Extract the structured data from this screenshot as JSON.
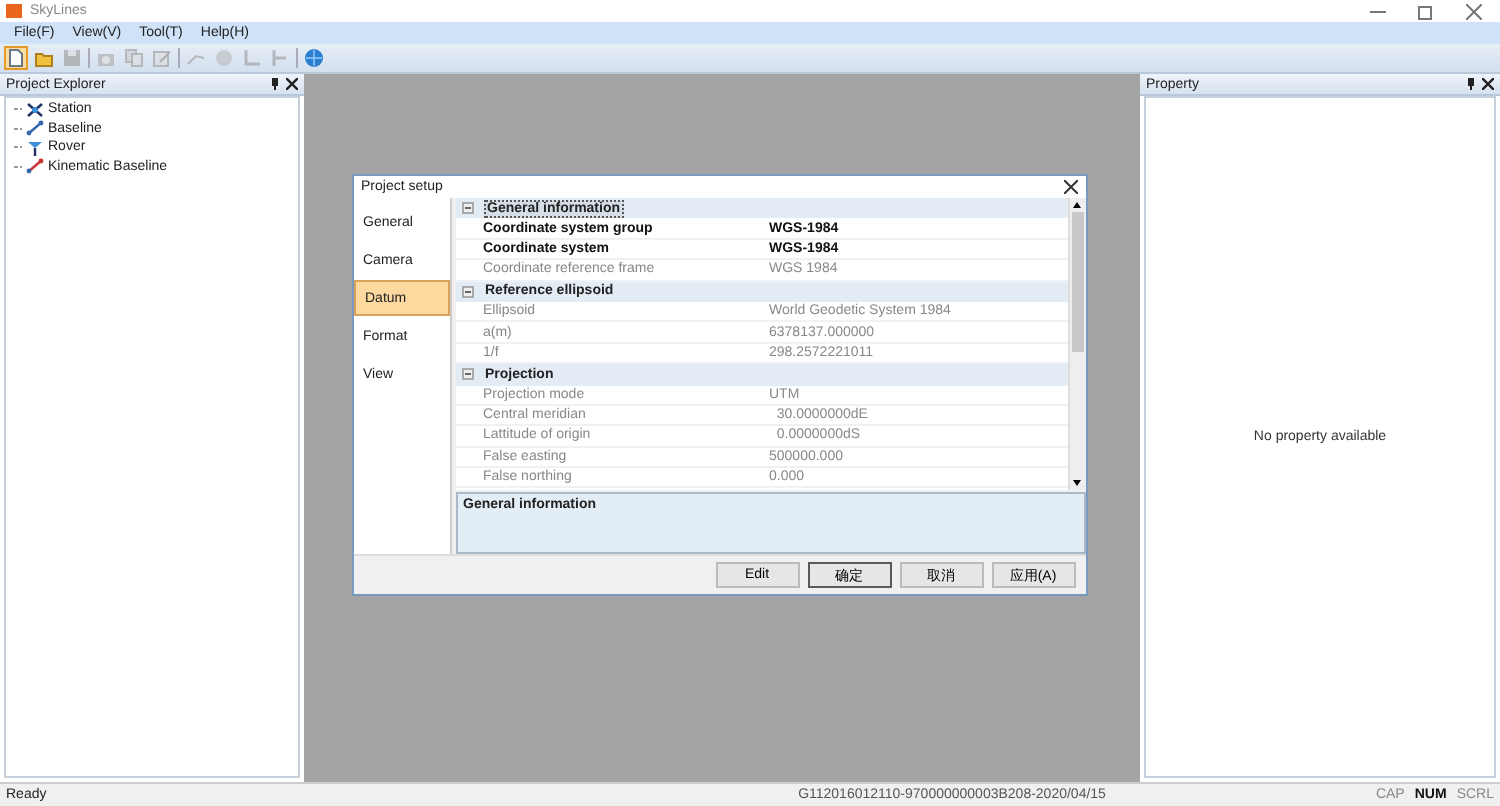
{
  "window": {
    "title": "SkyLines"
  },
  "menu": [
    "File(F)",
    "View(V)",
    "Tool(T)",
    "Help(H)"
  ],
  "toolbar": [
    {
      "kind": "new",
      "selected": true,
      "disabled": false
    },
    {
      "kind": "open",
      "selected": false,
      "disabled": false
    },
    {
      "kind": "save",
      "selected": false,
      "disabled": true
    },
    {
      "kind": "sep"
    },
    {
      "kind": "camera",
      "selected": false,
      "disabled": true
    },
    {
      "kind": "copy",
      "selected": false,
      "disabled": true
    },
    {
      "kind": "edit",
      "selected": false,
      "disabled": true
    },
    {
      "kind": "sep"
    },
    {
      "kind": "line",
      "selected": false,
      "disabled": true
    },
    {
      "kind": "circle",
      "selected": false,
      "disabled": true
    },
    {
      "kind": "corner",
      "selected": false,
      "disabled": true
    },
    {
      "kind": "step",
      "selected": false,
      "disabled": true
    },
    {
      "kind": "sep"
    },
    {
      "kind": "globe",
      "selected": false,
      "disabled": false
    }
  ],
  "project_explorer": {
    "title": "Project Explorer",
    "items": [
      {
        "label": "Station",
        "kind": "station"
      },
      {
        "label": "Baseline",
        "kind": "baseline"
      },
      {
        "label": "Rover",
        "kind": "rover"
      },
      {
        "label": "Kinematic Baseline",
        "kind": "kinematic"
      }
    ]
  },
  "property_panel": {
    "title": "Property",
    "empty_text": "No property available"
  },
  "dialog": {
    "title": "Project setup",
    "tabs": [
      {
        "label": "General",
        "selected": false
      },
      {
        "label": "Camera",
        "selected": false
      },
      {
        "label": "Datum",
        "selected": true
      },
      {
        "label": "Format",
        "selected": false
      },
      {
        "label": "View",
        "selected": false
      }
    ],
    "rows": [
      {
        "kind": "group",
        "label": "General information",
        "selected": true
      },
      {
        "kind": "property",
        "label": "Coordinate system group",
        "value": "WGS-1984",
        "disabled": false
      },
      {
        "kind": "property",
        "label": "Coordinate system",
        "value": "WGS-1984",
        "disabled": false
      },
      {
        "kind": "property",
        "label": "Coordinate reference frame",
        "value": "WGS 1984",
        "disabled": true
      },
      {
        "kind": "group",
        "label": "Reference ellipsoid",
        "selected": false
      },
      {
        "kind": "property",
        "label": "Ellipsoid",
        "value": "World Geodetic System 1984",
        "disabled": true
      },
      {
        "kind": "property",
        "label": "a(m)",
        "value": "6378137.000000",
        "disabled": true
      },
      {
        "kind": "property",
        "label": "1/f",
        "value": "298.2572221011",
        "disabled": true
      },
      {
        "kind": "group",
        "label": "Projection",
        "selected": false
      },
      {
        "kind": "property",
        "label": "Projection mode",
        "value": "UTM",
        "disabled": true
      },
      {
        "kind": "property",
        "label": "Central meridian",
        "value": "  30.0000000dE",
        "disabled": true
      },
      {
        "kind": "property",
        "label": "Lattitude of origin",
        "value": "  0.0000000dS",
        "disabled": true
      },
      {
        "kind": "property",
        "label": "False easting",
        "value": "500000.000",
        "disabled": true
      },
      {
        "kind": "property",
        "label": "False northing",
        "value": "0.000",
        "disabled": true
      }
    ],
    "description": "General information",
    "buttons": [
      {
        "label": "Edit",
        "default": false
      },
      {
        "label": "确定",
        "default": true
      },
      {
        "label": "取消",
        "default": false
      },
      {
        "label": "应用(A)",
        "default": false
      }
    ]
  },
  "status_bar": {
    "text": "Ready",
    "build": "G112016012110-970000000003B208-2020/04/15",
    "indicators": [
      {
        "label": "CAP",
        "on": false
      },
      {
        "label": "NUM",
        "on": true
      },
      {
        "label": "SCRL",
        "on": false
      }
    ]
  }
}
